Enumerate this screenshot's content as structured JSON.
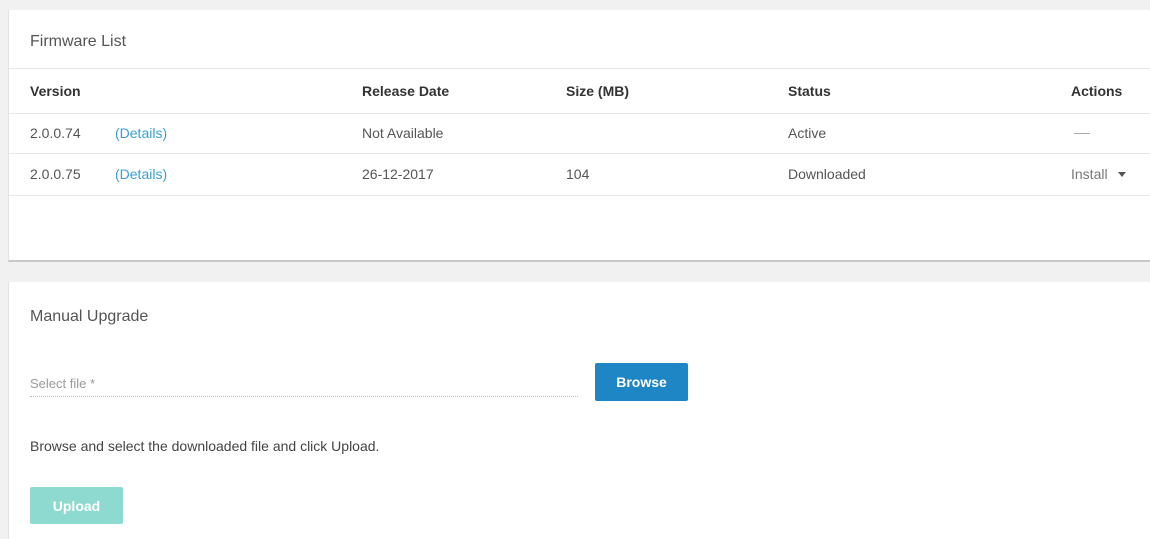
{
  "firmware_list": {
    "title": "Firmware List",
    "columns": {
      "version": "Version",
      "release_date": "Release Date",
      "size": "Size (MB)",
      "status": "Status",
      "actions": "Actions"
    },
    "rows": [
      {
        "version": "2.0.0.74",
        "details_link": "(Details)",
        "release_date": "Not Available",
        "size": "",
        "status": "Active",
        "action": "—"
      },
      {
        "version": "2.0.0.75",
        "details_link": "(Details)",
        "release_date": "26-12-2017",
        "size": "104",
        "status": "Downloaded",
        "action": "Install"
      }
    ]
  },
  "manual_upgrade": {
    "title": "Manual Upgrade",
    "file_input": {
      "value": "",
      "placeholder": "Select file *"
    },
    "browse_label": "Browse",
    "help_text": "Browse and select the downloaded file and click Upload.",
    "upload_label": "Upload",
    "upload_enabled": false
  },
  "colors": {
    "link": "#3a9fd5",
    "browse_button": "#1f86c5",
    "upload_button_disabled": "#8fdad0"
  },
  "icons": {
    "install_dropdown": "caret-down-icon"
  }
}
